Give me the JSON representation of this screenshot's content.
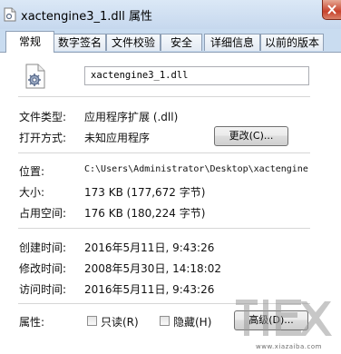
{
  "window": {
    "title": "xactengine3_1.dll 属性"
  },
  "tabs": [
    {
      "label": "常规",
      "active": true
    },
    {
      "label": "数字签名",
      "active": false
    },
    {
      "label": "文件校验",
      "active": false
    },
    {
      "label": "安全",
      "active": false
    },
    {
      "label": "详细信息",
      "active": false
    },
    {
      "label": "以前的版本",
      "active": false
    }
  ],
  "general": {
    "file_name": "xactengine3_1.dll",
    "file_type_label": "文件类型:",
    "file_type_value": "应用程序扩展 (.dll)",
    "opens_with_label": "打开方式:",
    "opens_with_value": "未知应用程序",
    "change_button": "更改(C)...",
    "location_label": "位置:",
    "location_value": "C:\\Users\\Administrator\\Desktop\\xactengine",
    "size_label": "大小:",
    "size_value": "173 KB (177,672 字节)",
    "size_on_disk_label": "占用空间:",
    "size_on_disk_value": "176 KB (180,224 字节)",
    "created_label": "创建时间:",
    "created_value": "2016年5月11日, 9:43:26",
    "modified_label": "修改时间:",
    "modified_value": "2008年5月30日, 14:18:02",
    "accessed_label": "访问时间:",
    "accessed_value": "2016年5月11日, 9:43:26",
    "attributes_label": "属性:",
    "readonly_label": "只读(R)",
    "hidden_label": "隐藏(H)",
    "advanced_button": "高级(D)..."
  },
  "watermark": {
    "text": "www.xiazaiba.com"
  },
  "colors": {
    "accent": "#c9dcf0",
    "close": "#c7422c",
    "panel": "#ffffff"
  },
  "icons": [
    "dll-file-icon",
    "gear-icon",
    "close-icon"
  ]
}
